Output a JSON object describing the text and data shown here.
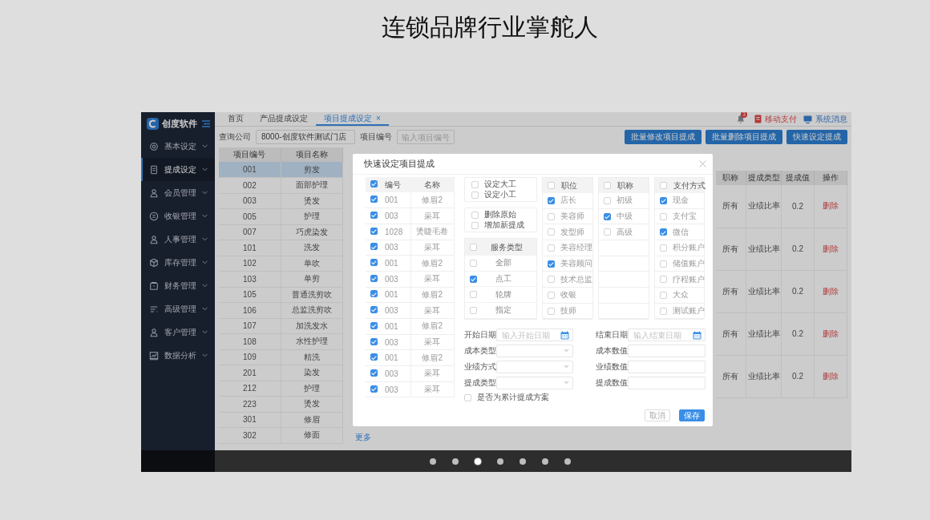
{
  "page_title": "连锁品牌行业掌舵人",
  "app": {
    "sidebar": {
      "logo": "创度软件",
      "items": [
        {
          "label": "基本设定",
          "selected": false
        },
        {
          "label": "提成设定",
          "selected": true
        },
        {
          "label": "会员管理",
          "selected": false
        },
        {
          "label": "收银管理",
          "selected": false
        },
        {
          "label": "人事管理",
          "selected": false
        },
        {
          "label": "库存管理",
          "selected": false
        },
        {
          "label": "财务管理",
          "selected": false
        },
        {
          "label": "高级管理",
          "selected": false
        },
        {
          "label": "客户管理",
          "selected": false
        },
        {
          "label": "数据分析",
          "selected": false
        }
      ]
    },
    "tabs": [
      {
        "label": "首页",
        "selected": false
      },
      {
        "label": "产品提成设定",
        "selected": false
      },
      {
        "label": "项目提成设定",
        "selected": true,
        "close": "×"
      }
    ],
    "header": {
      "notification_count": "3",
      "links": [
        {
          "label": "移动支付",
          "kind": "payment"
        },
        {
          "label": "系统消息",
          "kind": "message"
        }
      ]
    },
    "filters": [
      {
        "label": "查询公司",
        "value": "8000-创度软件测试门店"
      },
      {
        "label": "项目编号",
        "placeholder": "输入项目编号"
      }
    ],
    "action_buttons": [
      "批量修改项目提成",
      "批量删除项目提成",
      "快速设定提成"
    ],
    "items_table": {
      "columns": [
        "项目编号",
        "项目名称"
      ],
      "rows": [
        {
          "code": "001",
          "name": "剪发",
          "selected": true
        },
        {
          "code": "002",
          "name": "面部护理",
          "selected": false
        },
        {
          "code": "003",
          "name": "烫发",
          "selected": false
        },
        {
          "code": "005",
          "name": "护理",
          "selected": false
        },
        {
          "code": "007",
          "name": "巧虎染发",
          "selected": false
        },
        {
          "code": "101",
          "name": "洗发",
          "selected": false
        },
        {
          "code": "102",
          "name": "单吹",
          "selected": false
        },
        {
          "code": "103",
          "name": "单剪",
          "selected": false
        },
        {
          "code": "105",
          "name": "普通洗剪吹",
          "selected": false
        },
        {
          "code": "106",
          "name": "总监洗剪吹",
          "selected": false
        },
        {
          "code": "107",
          "name": "加洗发水",
          "selected": false
        },
        {
          "code": "108",
          "name": "水性护理",
          "selected": false
        },
        {
          "code": "109",
          "name": "精洗",
          "selected": false
        },
        {
          "code": "201",
          "name": "染发",
          "selected": false
        },
        {
          "code": "212",
          "name": "护理",
          "selected": false
        },
        {
          "code": "223",
          "name": "烫发",
          "selected": false
        },
        {
          "code": "301",
          "name": "修眉",
          "selected": false
        },
        {
          "code": "302",
          "name": "修面",
          "selected": false
        }
      ]
    },
    "more_link": "更多",
    "rules_table": {
      "columns": [
        "职称",
        "提成类型",
        "提成值",
        "操作"
      ],
      "rows": [
        {
          "title": "所有",
          "type": "业绩比率",
          "value": "0.2",
          "action": "删除"
        },
        {
          "title": "所有",
          "type": "业绩比率",
          "value": "0.2",
          "action": "删除"
        },
        {
          "title": "所有",
          "type": "业绩比率",
          "value": "0.2",
          "action": "删除"
        },
        {
          "title": "所有",
          "type": "业绩比率",
          "value": "0.2",
          "action": "删除"
        },
        {
          "title": "所有",
          "type": "业绩比率",
          "value": "0.2",
          "action": "删除"
        }
      ]
    }
  },
  "dialog": {
    "title": "快速设定项目提成",
    "items": {
      "header_checked": true,
      "columns": [
        "编号",
        "名称"
      ],
      "rows": [
        {
          "code": "001",
          "name": "修眉2",
          "checked": true
        },
        {
          "code": "003",
          "name": "采耳",
          "checked": true
        },
        {
          "code": "1028",
          "name": "烫睫毛卷",
          "checked": true
        },
        {
          "code": "003",
          "name": "采耳",
          "checked": true
        },
        {
          "code": "001",
          "name": "修眉2",
          "checked": true
        },
        {
          "code": "003",
          "name": "采耳",
          "checked": true
        },
        {
          "code": "001",
          "name": "修眉2",
          "checked": true
        },
        {
          "code": "003",
          "name": "采耳",
          "checked": true
        },
        {
          "code": "001",
          "name": "修眉2",
          "checked": true
        },
        {
          "code": "003",
          "name": "采耳",
          "checked": true
        },
        {
          "code": "001",
          "name": "修眉2",
          "checked": true
        },
        {
          "code": "003",
          "name": "采耳",
          "checked": true
        },
        {
          "code": "003",
          "name": "采耳",
          "checked": true
        }
      ]
    },
    "mode_options": [
      {
        "label": "设定大工",
        "checked": false
      },
      {
        "label": "设定小工",
        "checked": false
      }
    ],
    "action_options": [
      {
        "label": "删除原始",
        "checked": false
      },
      {
        "label": "增加新提成",
        "checked": false
      }
    ],
    "service_types": {
      "title": "服务类型",
      "header_checked": false,
      "options": [
        {
          "label": "全部",
          "checked": false
        },
        {
          "label": "点工",
          "checked": true
        },
        {
          "label": "轮牌",
          "checked": false
        },
        {
          "label": "指定",
          "checked": false
        }
      ]
    },
    "filter_columns": [
      {
        "title": "职位",
        "header_checked": false,
        "options": [
          {
            "label": "店长",
            "checked": true
          },
          {
            "label": "美容师",
            "checked": false
          },
          {
            "label": "发型师",
            "checked": false
          },
          {
            "label": "美容经理",
            "checked": false
          },
          {
            "label": "美容顾问",
            "checked": true
          },
          {
            "label": "技术总监",
            "checked": false
          },
          {
            "label": "收银",
            "checked": false
          },
          {
            "label": "技师",
            "checked": false
          }
        ]
      },
      {
        "title": "职称",
        "header_checked": false,
        "options": [
          {
            "label": "初级",
            "checked": false
          },
          {
            "label": "中级",
            "checked": true
          },
          {
            "label": "高级",
            "checked": false
          }
        ]
      },
      {
        "title": "支付方式",
        "header_checked": false,
        "options": [
          {
            "label": "现金",
            "checked": true
          },
          {
            "label": "支付宝",
            "checked": false
          },
          {
            "label": "微信",
            "checked": true
          },
          {
            "label": "积分账户",
            "checked": false
          },
          {
            "label": "储值账户",
            "checked": false
          },
          {
            "label": "疗程账户",
            "checked": false
          },
          {
            "label": "大众",
            "checked": false
          },
          {
            "label": "测试账户",
            "checked": false
          }
        ]
      }
    ],
    "form": [
      {
        "label": "开始日期",
        "kind": "date",
        "placeholder": "输入开始日期"
      },
      {
        "label": "结束日期",
        "kind": "date",
        "placeholder": "输入结束日期"
      },
      {
        "label": "成本类型",
        "kind": "select"
      },
      {
        "label": "成本数值",
        "kind": "text"
      },
      {
        "label": "业绩方式",
        "kind": "select"
      },
      {
        "label": "业绩数值",
        "kind": "text"
      },
      {
        "label": "提成类型",
        "kind": "select"
      },
      {
        "label": "提成数值",
        "kind": "text"
      }
    ],
    "cumulative": {
      "label": "是否为累计提成方案",
      "checked": false
    },
    "buttons": [
      {
        "label": "取消",
        "kind": "secondary"
      },
      {
        "label": "保存",
        "kind": "primary"
      }
    ]
  },
  "carousel": {
    "dots": [
      {
        "selected": false
      },
      {
        "selected": false
      },
      {
        "selected": true
      },
      {
        "selected": false
      },
      {
        "selected": false
      },
      {
        "selected": false
      },
      {
        "selected": false
      }
    ]
  }
}
